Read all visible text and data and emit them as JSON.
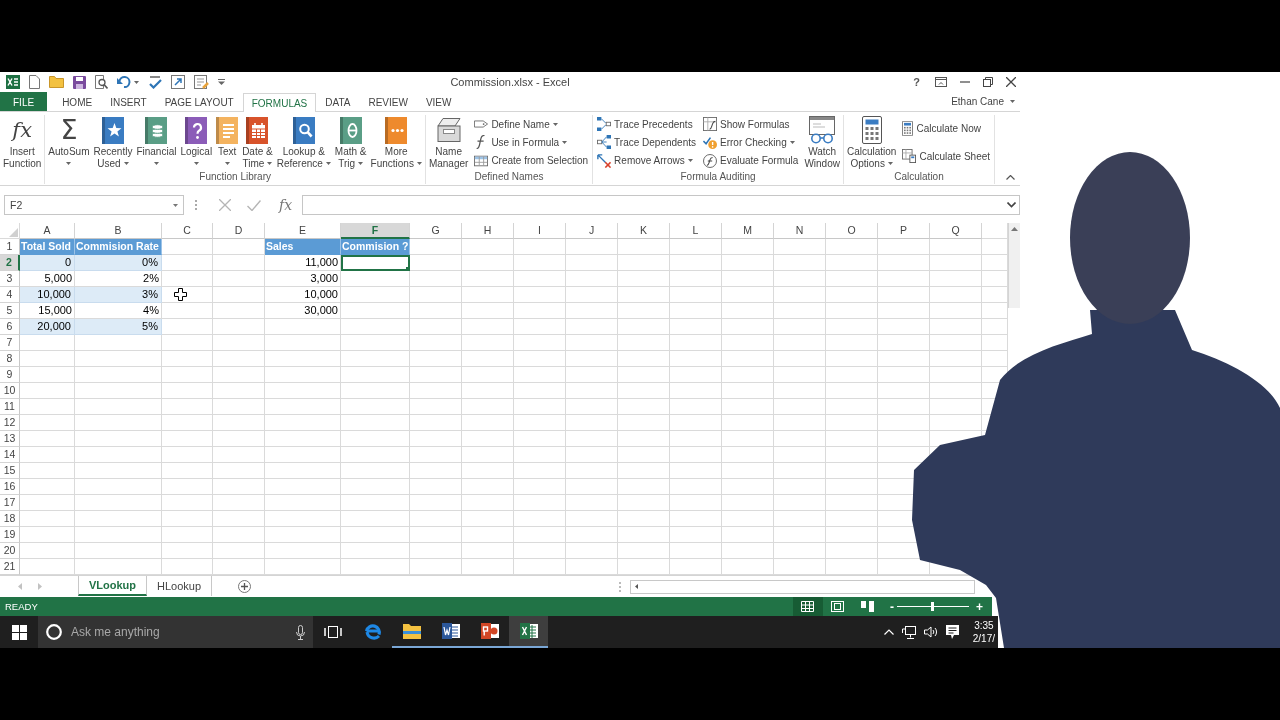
{
  "window": {
    "title": "Commission.xlsx - Excel",
    "help": "?"
  },
  "ribbon_tabs": [
    {
      "label": "FILE",
      "kind": "file",
      "selected": false
    },
    {
      "label": "HOME",
      "kind": "tab",
      "selected": false
    },
    {
      "label": "INSERT",
      "kind": "tab",
      "selected": false
    },
    {
      "label": "PAGE LAYOUT",
      "kind": "tab",
      "selected": false
    },
    {
      "label": "FORMULAS",
      "kind": "tab",
      "selected": true
    },
    {
      "label": "DATA",
      "kind": "tab",
      "selected": false
    },
    {
      "label": "REVIEW",
      "kind": "tab",
      "selected": false
    },
    {
      "label": "VIEW",
      "kind": "tab",
      "selected": false
    }
  ],
  "user": {
    "name": "Ethan Cane"
  },
  "ribbon_groups": [
    {
      "columns": [
        {
          "commands": [
            {
              "kind": "formula",
              "glyph": "fx",
              "lines": [
                "Insert",
                "Function"
              ],
              "dropdown": false
            }
          ]
        }
      ]
    },
    {
      "label": "Function Library",
      "columns": [
        {
          "commands": [
            {
              "kind": "sum",
              "glyph": "Σ",
              "lines": [
                "AutoSum"
              ],
              "dropdown": true
            },
            {
              "kind": "star",
              "color": "#3a7cc2",
              "lines": [
                "Recently",
                "Used"
              ],
              "dropdown": true
            },
            {
              "kind": "coins",
              "color": "#5a9e86",
              "lines": [
                "Financial"
              ],
              "dropdown": true
            },
            {
              "kind": "question",
              "color": "#8b5cb8",
              "lines": [
                "Logical"
              ],
              "dropdown": true
            },
            {
              "kind": "lines",
              "color": "#f4b35f",
              "lines": [
                "Text"
              ],
              "dropdown": true
            },
            {
              "kind": "calendar",
              "color": "#d8532b",
              "lines": [
                "Date &",
                "Time"
              ],
              "dropdown": true
            },
            {
              "kind": "magnifier",
              "color": "#3a7cc2",
              "lines": [
                "Lookup &",
                "Reference"
              ],
              "dropdown": true
            },
            {
              "kind": "theta",
              "color": "#5a9e86",
              "lines": [
                "Math &",
                "Trig"
              ],
              "dropdown": true
            },
            {
              "kind": "dots",
              "color": "#ee8a2d",
              "lines": [
                "More",
                "Functions"
              ],
              "dropdown": true
            }
          ]
        }
      ]
    },
    {
      "label": "Defined Names",
      "columns": [
        {
          "commands": [
            {
              "kind": "cards",
              "lines": [
                "Name",
                "Manager"
              ],
              "dropdown": false
            }
          ]
        },
        {
          "stack": [
            {
              "kind": "tag",
              "lines": [
                "Define Name"
              ],
              "dropdown": true
            },
            {
              "kind": "curve",
              "lines": [
                "Use in Formula"
              ],
              "dropdown": true
            },
            {
              "kind": "table",
              "lines": [
                "Create from Selection"
              ],
              "dropdown": false
            }
          ]
        }
      ]
    },
    {
      "label": "Formula Auditing",
      "columns": [
        {
          "stack": [
            {
              "kind": "precedents",
              "lines": [
                "Trace Precedents"
              ],
              "dropdown": false
            },
            {
              "kind": "dependents",
              "lines": [
                "Trace Dependents"
              ],
              "dropdown": false
            },
            {
              "kind": "unarrow",
              "lines": [
                "Remove Arrows"
              ],
              "dropdown": true
            }
          ]
        },
        {
          "stack": [
            {
              "kind": "formulas",
              "lines": [
                "Show Formulas"
              ],
              "dropdown": false
            },
            {
              "kind": "warning",
              "lines": [
                "Error Checking"
              ],
              "dropdown": true
            },
            {
              "kind": "evaluate",
              "lines": [
                "Evaluate Formula"
              ],
              "dropdown": false
            }
          ]
        },
        {
          "commands": [
            {
              "kind": "watch",
              "lines": [
                "Watch",
                "Window"
              ],
              "dropdown": false
            }
          ]
        }
      ]
    },
    {
      "label": "Calculation",
      "columns": [
        {
          "commands": [
            {
              "kind": "calculator",
              "lines": [
                "Calculation",
                "Options"
              ],
              "dropdown": true
            }
          ]
        },
        {
          "stack": [
            {
              "kind": "calculator",
              "lines": [
                "Calculate Now"
              ],
              "dropdown": false
            },
            {
              "kind": "sheet",
              "lines": [
                "Calculate Sheet"
              ],
              "dropdown": false
            }
          ]
        }
      ]
    }
  ],
  "formula_bar": {
    "name_box": "F2",
    "function_button": "fx"
  },
  "sheet": {
    "columns": [
      {
        "label": "A",
        "selected": false
      },
      {
        "label": "B",
        "selected": false
      },
      {
        "label": "C",
        "selected": false
      },
      {
        "label": "D",
        "selected": false
      },
      {
        "label": "E",
        "selected": false
      },
      {
        "label": "F",
        "selected": true
      },
      {
        "label": "G",
        "selected": false
      },
      {
        "label": "H",
        "selected": false
      },
      {
        "label": "I",
        "selected": false
      },
      {
        "label": "J",
        "selected": false
      },
      {
        "label": "K",
        "selected": false
      },
      {
        "label": "L",
        "selected": false
      },
      {
        "label": "M",
        "selected": false
      },
      {
        "label": "N",
        "selected": false
      },
      {
        "label": "O",
        "selected": false
      },
      {
        "label": "P",
        "selected": false
      },
      {
        "label": "Q",
        "selected": false
      }
    ],
    "rows": [
      {
        "label": "1",
        "selected": false
      },
      {
        "label": "2",
        "selected": true
      },
      {
        "label": "3",
        "selected": false
      },
      {
        "label": "4",
        "selected": false
      },
      {
        "label": "5",
        "selected": false
      },
      {
        "label": "6",
        "selected": false
      },
      {
        "label": "7",
        "selected": false
      },
      {
        "label": "8",
        "selected": false
      },
      {
        "label": "9",
        "selected": false
      },
      {
        "label": "10",
        "selected": false
      },
      {
        "label": "11",
        "selected": false
      },
      {
        "label": "12",
        "selected": false
      },
      {
        "label": "13",
        "selected": false
      },
      {
        "label": "14",
        "selected": false
      },
      {
        "label": "15",
        "selected": false
      },
      {
        "label": "16",
        "selected": false
      },
      {
        "label": "17",
        "selected": false
      },
      {
        "label": "18",
        "selected": false
      },
      {
        "label": "19",
        "selected": false
      },
      {
        "label": "20",
        "selected": false
      },
      {
        "label": "21",
        "selected": false
      }
    ]
  },
  "rate_table": {
    "columns": [
      "Total Sold",
      "Commision Rate"
    ],
    "rows": [
      [
        "0",
        "0%"
      ],
      [
        "5,000",
        "2%"
      ],
      [
        "10,000",
        "3%"
      ],
      [
        "15,000",
        "4%"
      ],
      [
        "20,000",
        "5%"
      ]
    ]
  },
  "sales_table": {
    "columns": [
      "Sales",
      "Commision ?"
    ],
    "rows": [
      {
        "sales": "11,000",
        "commission_selected": true
      },
      {
        "sales": "3,000",
        "commission_selected": false
      },
      {
        "sales": "10,000",
        "commission_selected": false
      },
      {
        "sales": "30,000",
        "commission_selected": false
      }
    ]
  },
  "sheet_tabs": [
    {
      "label": "VLookup",
      "selected": true
    },
    {
      "label": "HLookup",
      "selected": false
    }
  ],
  "status_bar": {
    "mode": "READY",
    "views": [
      {
        "kind": "normal",
        "selected": true
      },
      {
        "kind": "layout",
        "selected": false
      },
      {
        "kind": "breaks",
        "selected": false
      }
    ],
    "zoom": {
      "out": "-",
      "in": "+",
      "level": 0.5
    }
  },
  "taskbar": {
    "search": {
      "placeholder": "Ask me anything"
    },
    "apps": [
      {
        "kind": "browser",
        "running": false,
        "active": false
      },
      {
        "kind": "folder",
        "running": true,
        "active": false
      },
      {
        "kind": "word",
        "running": true,
        "active": false
      },
      {
        "kind": "slides",
        "running": true,
        "active": false
      },
      {
        "kind": "excel",
        "running": true,
        "active": true
      }
    ],
    "clock": {
      "time": "3:35",
      "date": "2/17/"
    }
  }
}
